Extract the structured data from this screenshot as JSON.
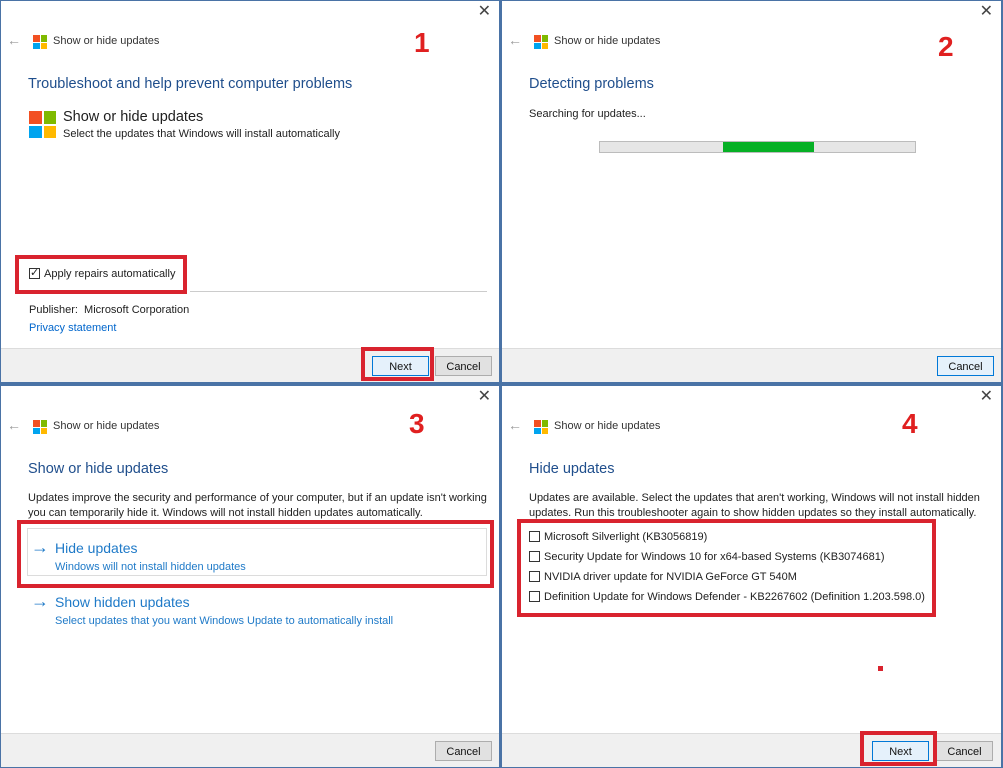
{
  "window_title": "Show or hide updates",
  "step_labels": [
    "1",
    "2",
    "3",
    "4"
  ],
  "panel1": {
    "heading": "Troubleshoot and help prevent computer problems",
    "app_name": "Show or hide updates",
    "app_desc": "Select the updates that Windows will install automatically",
    "checkbox_label": "Apply repairs automatically",
    "checkbox_checked": true,
    "publisher_label": "Publisher:",
    "publisher_value": "Microsoft Corporation",
    "privacy_link": "Privacy statement",
    "next_label": "Next",
    "cancel_label": "Cancel"
  },
  "panel2": {
    "heading": "Detecting problems",
    "status": "Searching for updates...",
    "progress_start_fraction": 0.39,
    "progress_fill_fraction": 0.29,
    "cancel_label": "Cancel"
  },
  "panel3": {
    "heading": "Show or hide updates",
    "intro": "Updates improve the security and performance of your computer, but if an update isn't working you can temporarily hide it. Windows will not install hidden updates automatically.",
    "option1_title": "Hide updates",
    "option1_sub": "Windows will not install hidden updates",
    "option2_title": "Show hidden updates",
    "option2_sub": "Select updates that you want Windows Update to automatically install",
    "cancel_label": "Cancel"
  },
  "panel4": {
    "heading": "Hide updates",
    "intro": "Updates are available. Select the updates that aren't working, Windows will not install hidden updates. Run this troubleshooter again to show hidden updates so they install automatically.",
    "updates": [
      "Microsoft Silverlight (KB3056819)",
      "Security Update for Windows 10 for x64-based Systems (KB3074681)",
      "NVIDIA driver update for NVIDIA GeForce GT 540M",
      "Definition Update for Windows Defender - KB2267602 (Definition 1.203.598.0)"
    ],
    "next_label": "Next",
    "cancel_label": "Cancel"
  },
  "colors": {
    "accent": "#1f4e8c",
    "link": "#1f7ac8",
    "highlight": "#d9232e",
    "progress": "#06b025",
    "step": "#e02020"
  },
  "icons": [
    "close-icon",
    "back-arrow-icon",
    "windows-logo-icon",
    "arrow-right-icon",
    "checkbox-icon"
  ]
}
